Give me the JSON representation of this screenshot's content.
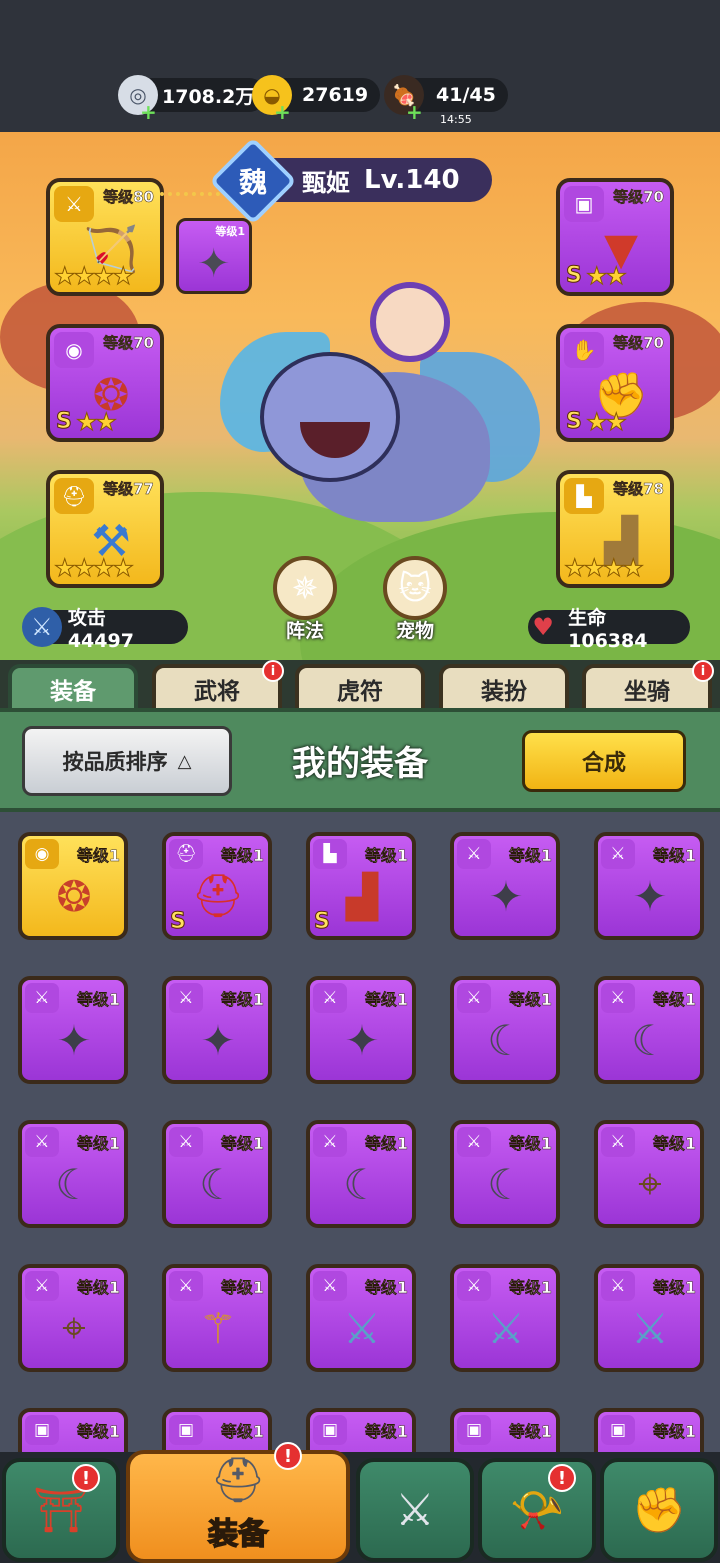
{
  "resources": {
    "silver": "1708.2万",
    "gold": "27619",
    "stamina": "41/45",
    "stamina_timer": "14:55"
  },
  "hero": {
    "kingdom": "魏",
    "name": "甄姬",
    "level": "Lv.140"
  },
  "equipped": {
    "weapon_level": "等级80",
    "weapon_sub_level": "等级1",
    "accessory_level": "等级70",
    "helmet_level": "等级77",
    "armor_level": "等级70",
    "gloves_level": "等级70",
    "boots_level": "等级78",
    "s_label": "S"
  },
  "actions": {
    "formation": "阵法",
    "pet": "宠物"
  },
  "stats": {
    "attack": "攻击  44497",
    "hp": "生命106384"
  },
  "tabs": [
    "装备",
    "武将",
    "虎符",
    "装扮",
    "坐骑"
  ],
  "tab_badge": "i",
  "panel": {
    "sort_label": "按品质排序",
    "sort_arrow": "△",
    "title": "我的装备",
    "merge_label": "合成"
  },
  "items": [
    {
      "level": "等级1",
      "tier": "gold",
      "type": "accessory-icon",
      "s": ""
    },
    {
      "level": "等级1",
      "tier": "purple",
      "type": "helmet-icon",
      "s": "S"
    },
    {
      "level": "等级1",
      "tier": "purple",
      "type": "boots-icon",
      "s": "S"
    },
    {
      "level": "等级1",
      "tier": "purple",
      "type": "shuriken-icon",
      "s": ""
    },
    {
      "level": "等级1",
      "tier": "purple",
      "type": "shuriken-icon",
      "s": ""
    },
    {
      "level": "等级1",
      "tier": "purple",
      "type": "shuriken-icon",
      "s": ""
    },
    {
      "level": "等级1",
      "tier": "purple",
      "type": "shuriken-icon",
      "s": ""
    },
    {
      "level": "等级1",
      "tier": "purple",
      "type": "shuriken-icon",
      "s": ""
    },
    {
      "level": "等级1",
      "tier": "purple",
      "type": "scimitar-icon",
      "s": ""
    },
    {
      "level": "等级1",
      "tier": "purple",
      "type": "scimitar-icon",
      "s": ""
    },
    {
      "level": "等级1",
      "tier": "purple",
      "type": "scimitar-icon",
      "s": ""
    },
    {
      "level": "等级1",
      "tier": "purple",
      "type": "scimitar-icon",
      "s": ""
    },
    {
      "level": "等级1",
      "tier": "purple",
      "type": "scimitar-icon",
      "s": ""
    },
    {
      "level": "等级1",
      "tier": "purple",
      "type": "scimitar-icon",
      "s": ""
    },
    {
      "level": "等级1",
      "tier": "purple",
      "type": "crossbow-icon",
      "s": ""
    },
    {
      "level": "等级1",
      "tier": "purple",
      "type": "crossbow-icon",
      "s": ""
    },
    {
      "level": "等级1",
      "tier": "purple",
      "type": "golden-gun-icon",
      "s": ""
    },
    {
      "level": "等级1",
      "tier": "purple",
      "type": "broadsword-icon",
      "s": ""
    },
    {
      "level": "等级1",
      "tier": "purple",
      "type": "broadsword-icon",
      "s": ""
    },
    {
      "level": "等级1",
      "tier": "purple",
      "type": "broadsword-icon",
      "s": ""
    },
    {
      "level": "等级1",
      "tier": "purple",
      "type": "armor-icon",
      "s": ""
    },
    {
      "level": "等级1",
      "tier": "purple",
      "type": "armor-icon",
      "s": ""
    },
    {
      "level": "等级1",
      "tier": "purple",
      "type": "armor-icon",
      "s": ""
    },
    {
      "level": "等级1",
      "tier": "purple",
      "type": "armor-icon",
      "s": ""
    },
    {
      "level": "等级1",
      "tier": "purple",
      "type": "armor-icon",
      "s": ""
    }
  ],
  "bottom_nav": {
    "active_label": "装备",
    "badge": "!"
  }
}
